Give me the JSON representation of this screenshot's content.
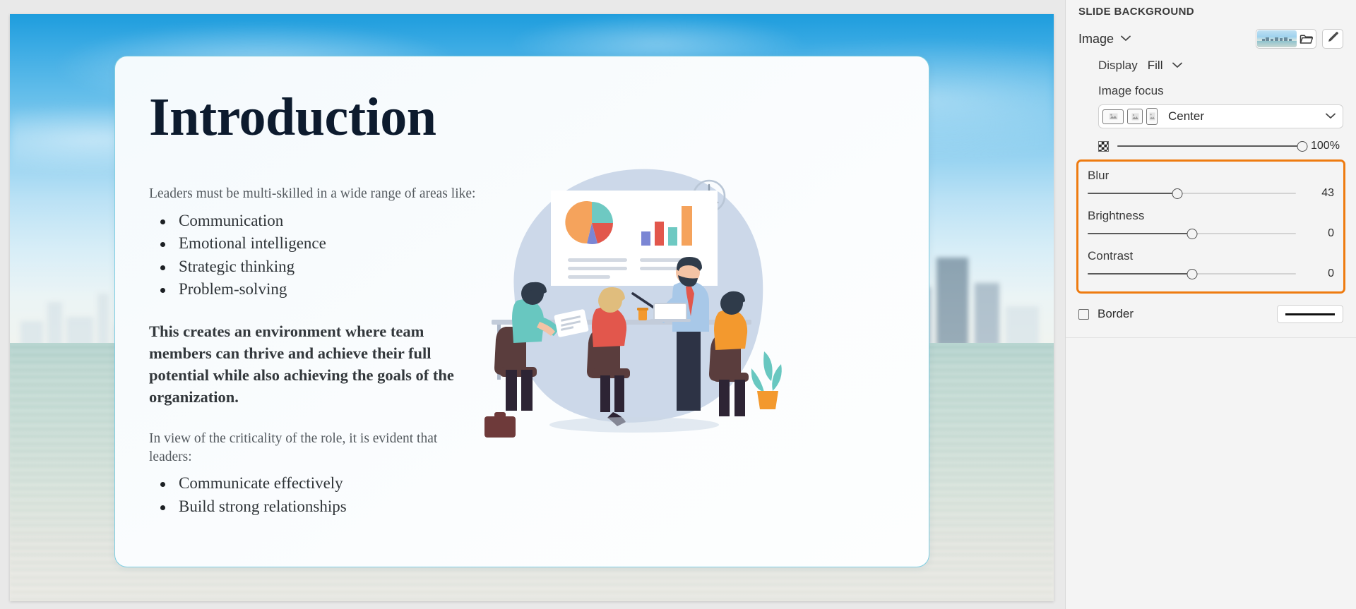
{
  "panel": {
    "title": "SLIDE BACKGROUND",
    "fill_type": {
      "label": "Image",
      "chevron_icon": "chevron-down-icon"
    },
    "image_buttons": {
      "thumbnail_icon": "image-thumbnail",
      "folder_icon": "folder-icon",
      "edit_icon": "pencil-icon"
    },
    "display": {
      "label": "Display",
      "value": "Fill",
      "chevron_icon": "chevron-down-icon"
    },
    "image_focus": {
      "label": "Image focus",
      "ratios": [
        {
          "name": "landscape",
          "icon": "image-landscape-icon"
        },
        {
          "name": "square",
          "icon": "image-square-icon"
        },
        {
          "name": "portrait",
          "icon": "image-portrait-icon"
        }
      ],
      "value": "Center",
      "chevron_icon": "chevron-down-icon"
    },
    "opacity": {
      "icon": "checkerboard-icon",
      "value": "100%",
      "percent": 100
    },
    "adjustments": {
      "highlight_color": "#ee7b10",
      "items": [
        {
          "label": "Blur",
          "value": "43",
          "percent": 43
        },
        {
          "label": "Brightness",
          "value": "0",
          "percent": 50
        },
        {
          "label": "Contrast",
          "value": "0",
          "percent": 50
        }
      ]
    },
    "border": {
      "label": "Border",
      "checked": false,
      "stroke_icon": "line-stroke-icon"
    }
  },
  "slide": {
    "title": "Introduction",
    "blocks": [
      {
        "kind": "para",
        "text": "Leaders must be multi-skilled in a wide range of areas like:"
      },
      {
        "kind": "list",
        "items": [
          "Communication",
          "Emotional intelligence",
          "Strategic thinking",
          "Problem-solving"
        ]
      },
      {
        "kind": "para_strong",
        "text": "This creates an environment where team members can thrive and achieve their full potential while also achieving the goals of the organization."
      },
      {
        "kind": "para",
        "text": "In view of the criticality of the role, it is evident that leaders:"
      },
      {
        "kind": "list",
        "items": [
          "Communicate effectively",
          "Build strong relationships"
        ]
      }
    ],
    "intro_paragraph": "Leaders must be multi-skilled in a wide range of areas like:",
    "bullets_one": [
      "Communication",
      "Emotional intelligence",
      "Strategic thinking",
      "Problem-solving"
    ],
    "middle_paragraph": "This creates an environment where team members can thrive and achieve their full potential while also achieving the goals of the organization.",
    "second_paragraph": "In view of the criticality of the role, it is evident that leaders:",
    "bullets_two": [
      "Communicate effectively",
      "Build strong relationships"
    ],
    "illustration": {
      "name": "business-presentation-illustration",
      "accent_colors": [
        "#f5a35c",
        "#68c7c0",
        "#e2574c",
        "#7b86d4",
        "#a9c2e0"
      ]
    },
    "background_image": "city-skyline-waterfront-photo"
  }
}
